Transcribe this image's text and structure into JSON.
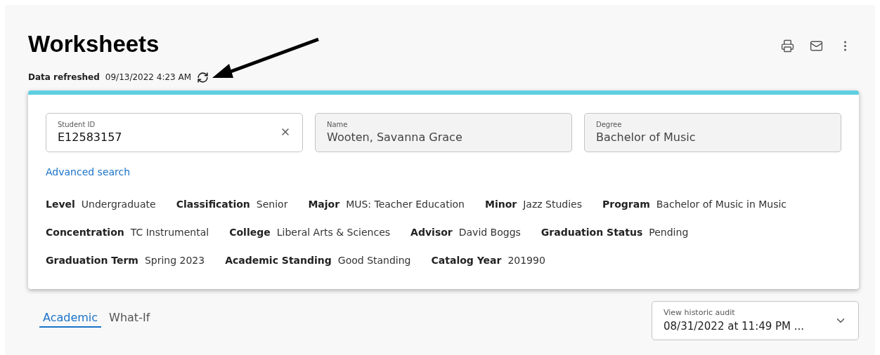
{
  "header": {
    "title": "Worksheets",
    "refreshed_label": "Data refreshed",
    "refreshed_value": "09/13/2022 4:23 AM"
  },
  "toolbar": [
    {
      "kind": "print"
    },
    {
      "kind": "email"
    },
    {
      "kind": "more"
    }
  ],
  "fields": [
    {
      "label": "Student ID",
      "value": "E12583157",
      "disabled": false,
      "clearable": true
    },
    {
      "label": "Name",
      "value": "Wooten, Savanna Grace",
      "disabled": true,
      "clearable": false
    },
    {
      "label": "Degree",
      "value": "Bachelor of Music",
      "disabled": true,
      "clearable": false
    }
  ],
  "advanced_search": "Advanced search",
  "details": [
    [
      {
        "label": "Level",
        "value": "Undergraduate"
      },
      {
        "label": "Classification",
        "value": "Senior"
      },
      {
        "label": "Major",
        "value": "MUS: Teacher Education"
      },
      {
        "label": "Minor",
        "value": "Jazz Studies"
      },
      {
        "label": "Program",
        "value": "Bachelor of Music in Music"
      }
    ],
    [
      {
        "label": "Concentration",
        "value": "TC Instrumental"
      },
      {
        "label": "College",
        "value": "Liberal Arts & Sciences"
      },
      {
        "label": "Advisor",
        "value": "David Boggs"
      },
      {
        "label": "Graduation Status",
        "value": "Pending"
      }
    ],
    [
      {
        "label": "Graduation Term",
        "value": "Spring 2023"
      },
      {
        "label": "Academic Standing",
        "value": "Good Standing"
      },
      {
        "label": "Catalog Year",
        "value": "201990"
      }
    ]
  ],
  "tabs": [
    {
      "label": "Academic",
      "selected": true
    },
    {
      "label": "What-If",
      "selected": false
    }
  ],
  "historic_audit": {
    "label": "View historic audit",
    "value": "08/31/2022 at 11:49 PM ..."
  }
}
